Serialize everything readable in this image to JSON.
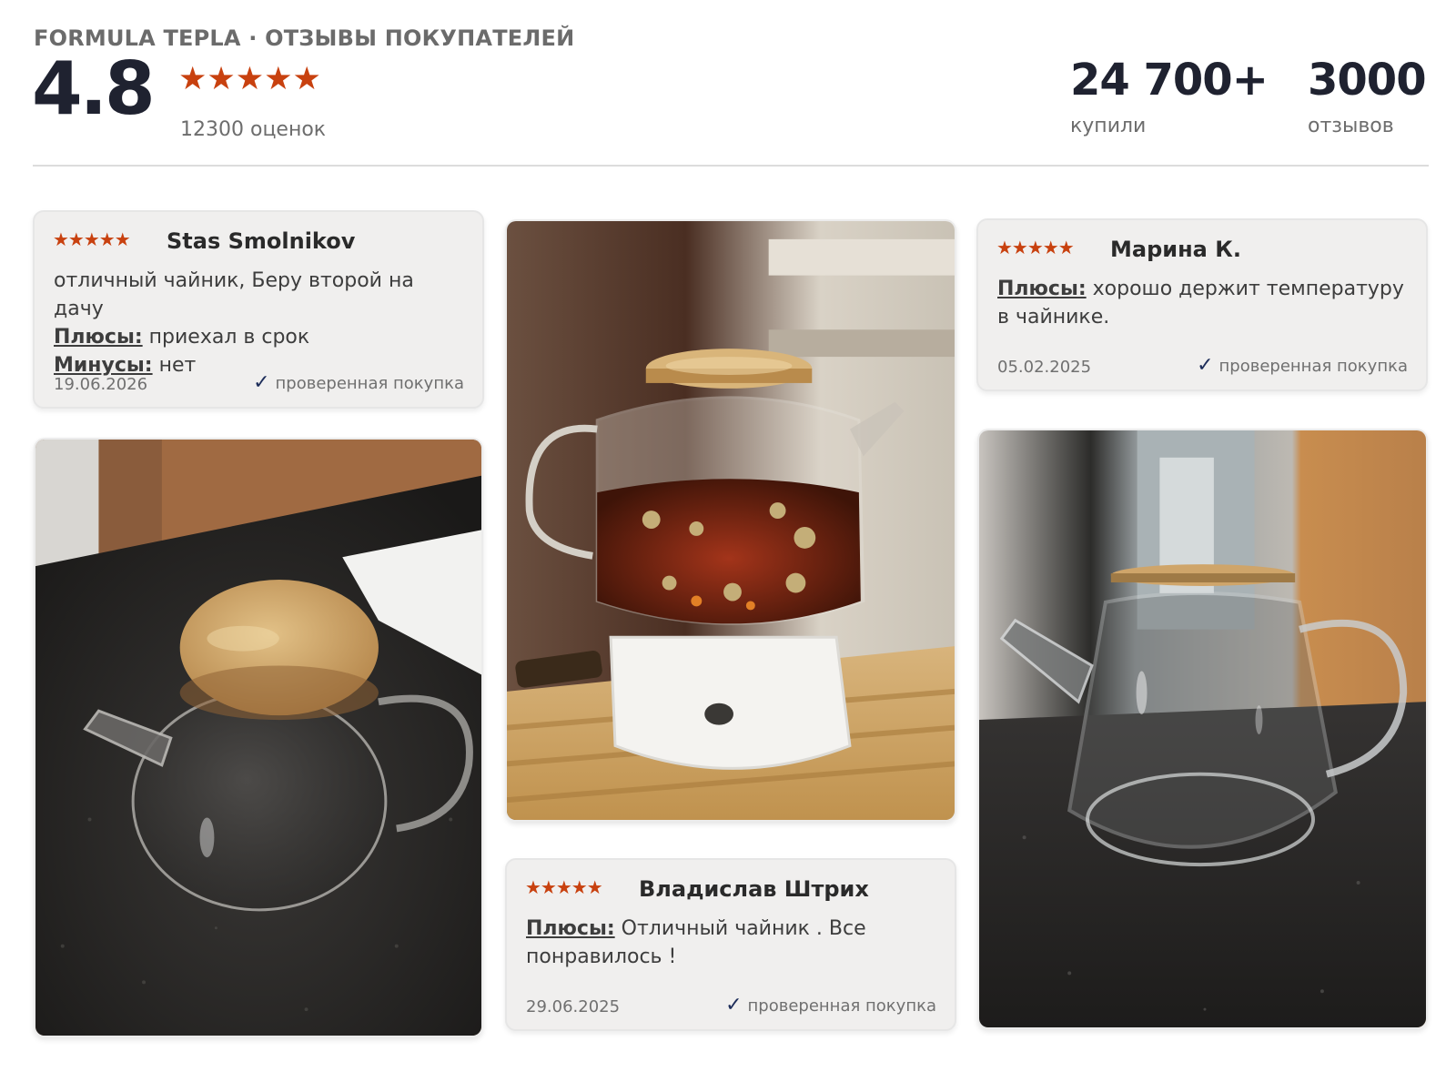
{
  "header": {
    "brand_title": "FORMULA TEPLA · ОТЗЫВЫ ПОКУПАТЕЛЕЙ",
    "rating_value": "4.8",
    "rating_stars": "★★★★★",
    "ratings_count_label": "12300 оценок",
    "stats": [
      {
        "value": "24 700+",
        "label": "купили"
      },
      {
        "value": "3000",
        "label": "отзывов"
      }
    ]
  },
  "reviews": [
    {
      "stars": "★★★★★",
      "author": "Stas Smolnikov",
      "text": "отличный чайник, Беру второй на дачу",
      "pros_label": "Плюсы:",
      "pros": "приехал в срок",
      "cons_label": "Минусы:",
      "cons": "нет",
      "date": "19.06.2026",
      "verified": "проверенная покупка"
    },
    {
      "stars": "★★★★★",
      "author": "Марина К.",
      "pros_label": "Плюсы:",
      "pros": "хорошо держит температуру в чайнике.",
      "date": "05.02.2025",
      "verified": "проверенная покупка"
    },
    {
      "stars": "★★★★★",
      "author": "Владислав Штрих",
      "pros_label": "Плюсы:",
      "pros": "Отличный чайник . Все понравилось !",
      "date": "29.06.2025",
      "verified": "проверенная покупка"
    }
  ],
  "icons": {
    "star": "star-icon",
    "check": "check-icon"
  },
  "colors": {
    "accent_star": "#c8410f",
    "heading": "#1f2230",
    "card_bg": "#f0efee",
    "check": "#1d2d5a"
  }
}
